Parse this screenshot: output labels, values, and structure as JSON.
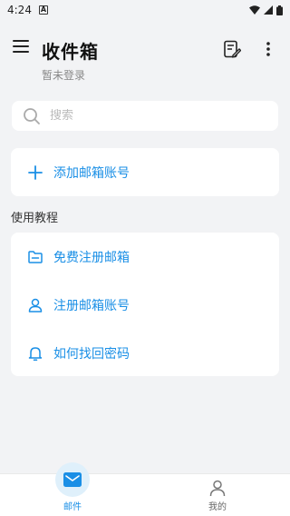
{
  "status_bar": {
    "time": "4:24",
    "notification_glyph": "A"
  },
  "header": {
    "title": "收件箱",
    "subtitle": "暂未登录"
  },
  "search": {
    "placeholder": "搜索"
  },
  "add_account": {
    "label": "添加邮箱账号"
  },
  "tutorial": {
    "section_title": "使用教程",
    "items": [
      {
        "label": "免费注册邮箱",
        "icon": "folder-icon"
      },
      {
        "label": "注册邮箱账号",
        "icon": "user-icon"
      },
      {
        "label": "如何找回密码",
        "icon": "bell-icon"
      }
    ]
  },
  "bottom_nav": {
    "items": [
      {
        "label": "邮件",
        "icon": "mail-icon",
        "active": true
      },
      {
        "label": "我的",
        "icon": "profile-icon",
        "active": false
      }
    ]
  },
  "colors": {
    "accent": "#1a8fe6",
    "background": "#f2f3f5",
    "card": "#ffffff"
  }
}
